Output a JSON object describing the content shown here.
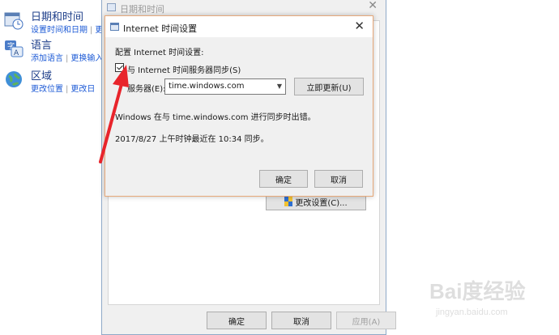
{
  "control_panel": {
    "items": [
      {
        "title": "日期和时间",
        "links": [
          "设置时间和日期",
          "更"
        ],
        "icon": "clock-calendar-icon"
      },
      {
        "title": "语言",
        "links": [
          "添加语言",
          "更换输入"
        ],
        "icon": "language-icon"
      },
      {
        "title": "区域",
        "links": [
          "更改位置",
          "更改日"
        ],
        "icon": "globe-icon"
      }
    ]
  },
  "back_dialog": {
    "title": "日期和时间",
    "change_settings_label": "更改设置(C)...",
    "ok_label": "确定",
    "cancel_label": "取消",
    "apply_label": "应用(A)"
  },
  "front_dialog": {
    "title": "Internet 时间设置",
    "configure_label": "配置 Internet 时间设置:",
    "sync_checkbox_label": "与 Internet 时间服务器同步(S)",
    "sync_checked": true,
    "server_label": "服务器(E):",
    "server_value": "time.windows.com",
    "update_now_label": "立即更新(U)",
    "error_message": "Windows 在与 time.windows.com 进行同步时出错。",
    "last_sync_message": "2017/8/27 上午时钟最近在 10:34 同步。",
    "ok_label": "确定",
    "cancel_label": "取消"
  },
  "annotation": {
    "color": "#e8242b"
  },
  "watermark": {
    "main": "Bai度经验",
    "sub": "jingyan.baidu.com"
  }
}
